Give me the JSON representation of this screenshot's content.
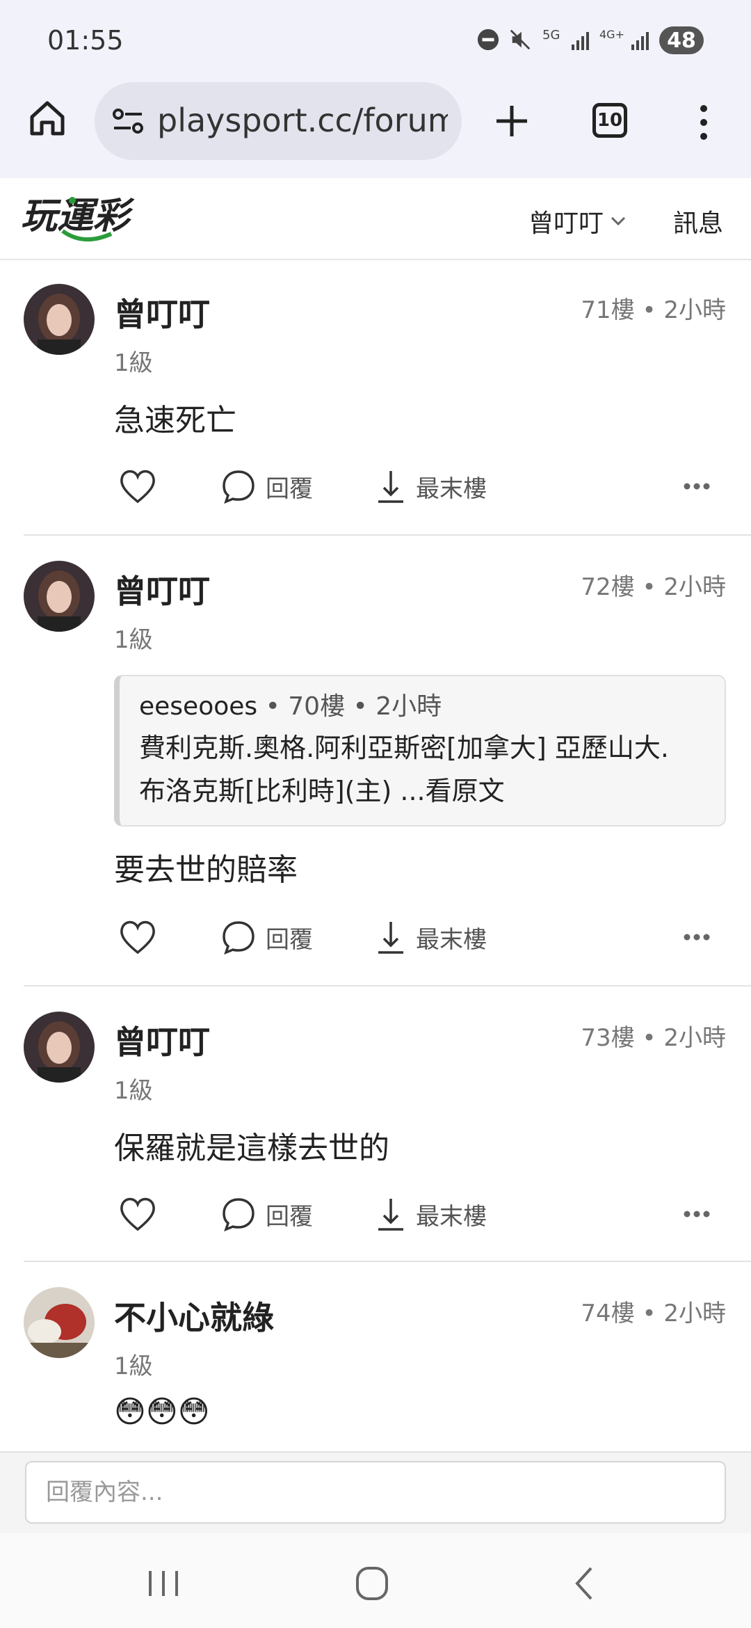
{
  "status_bar": {
    "time": "01:55",
    "network_5g": "5G",
    "network_4g": "4G+",
    "battery": "48"
  },
  "browser": {
    "url": "playsport.cc/forum/p",
    "tab_count": "10"
  },
  "site": {
    "logo_text": "玩運彩",
    "user_name": "曾叮叮",
    "messages_label": "訊息"
  },
  "posts": [
    {
      "username": "曾叮叮",
      "floor": "71樓",
      "time": "2小時",
      "level": "1級",
      "content": "急速死亡",
      "reply_label": "回覆",
      "last_floor_label": "最末樓"
    },
    {
      "username": "曾叮叮",
      "floor": "72樓",
      "time": "2小時",
      "level": "1級",
      "content": "要去世的賠率",
      "quote": {
        "user": "eeseooes",
        "floor": "70樓",
        "time": "2小時",
        "line1": "費利克斯.奧格.阿利亞斯密[加拿大] 亞歷山大.",
        "line2": "布洛克斯[比利時](主) ...看原文"
      },
      "reply_label": "回覆",
      "last_floor_label": "最末樓"
    },
    {
      "username": "曾叮叮",
      "floor": "73樓",
      "time": "2小時",
      "level": "1級",
      "content": "保羅就是這樣去世的",
      "reply_label": "回覆",
      "last_floor_label": "最末樓"
    },
    {
      "username": "不小心就綠",
      "floor": "74樓",
      "time": "2小時",
      "level": "1級",
      "content": "😳😳😳"
    }
  ],
  "reply_bar": {
    "placeholder": "回覆內容..."
  },
  "colors": {
    "accent_green": "#2a9d3a",
    "toolbar_bg": "#f2f2fb"
  }
}
